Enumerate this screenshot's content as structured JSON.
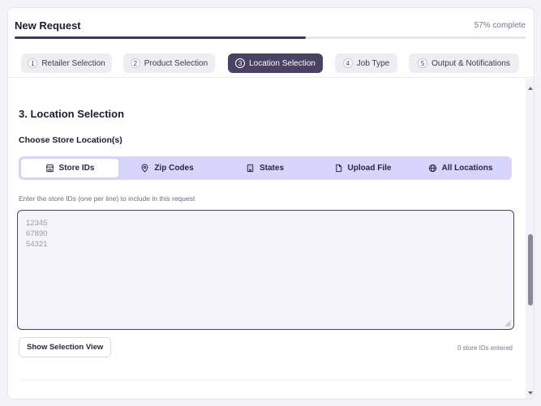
{
  "header": {
    "title": "New Request",
    "progress_text": "57% complete",
    "progress_value": 57
  },
  "steps": [
    {
      "number": "1",
      "label": "Retailer Selection",
      "active": false
    },
    {
      "number": "2",
      "label": "Product Selection",
      "active": false
    },
    {
      "number": "3",
      "label": "Location Selection",
      "active": true
    },
    {
      "number": "4",
      "label": "Job Type",
      "active": false
    },
    {
      "number": "5",
      "label": "Output & Notifications",
      "active": false
    }
  ],
  "main": {
    "section_title": "3. Location Selection",
    "subtitle": "Choose Store Location(s)",
    "tabs": [
      {
        "label": "Store IDs",
        "icon": "store-icon",
        "active": true
      },
      {
        "label": "Zip Codes",
        "icon": "map-pin-icon",
        "active": false
      },
      {
        "label": "States",
        "icon": "building-icon",
        "active": false
      },
      {
        "label": "Upload File",
        "icon": "file-icon",
        "active": false
      },
      {
        "label": "All Locations",
        "icon": "globe-icon",
        "active": false
      }
    ],
    "hint": "Enter the store IDs (one per line) to include in this request",
    "textarea": {
      "value": "",
      "placeholder": "12345\n67890\n54321"
    },
    "show_selection_label": "Show Selection View",
    "count_text": "0 store IDs entered"
  },
  "colors": {
    "accent": "#4a4263",
    "segment_bg": "#d8d4fb",
    "progress_fill": "#3f3857"
  }
}
